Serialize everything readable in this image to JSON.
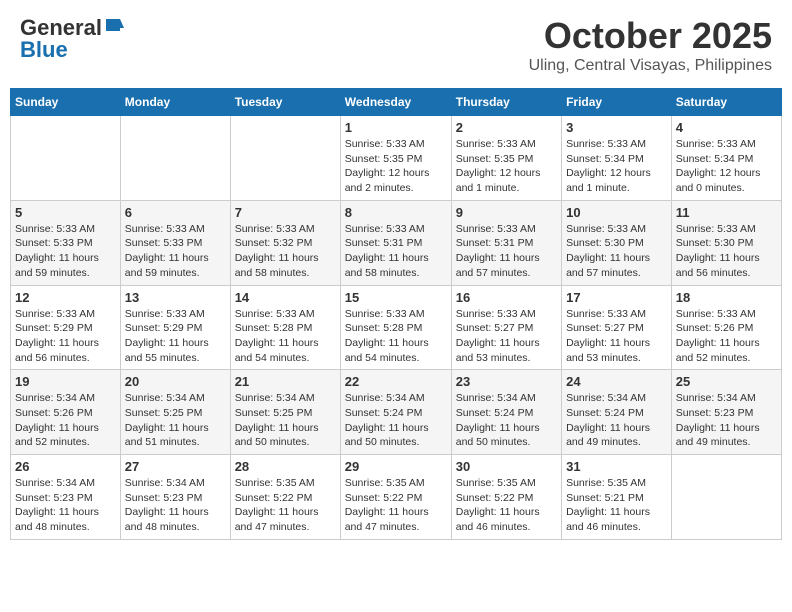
{
  "header": {
    "logo_line1": "General",
    "logo_line2": "Blue",
    "month": "October 2025",
    "location": "Uling, Central Visayas, Philippines"
  },
  "days_of_week": [
    "Sunday",
    "Monday",
    "Tuesday",
    "Wednesday",
    "Thursday",
    "Friday",
    "Saturday"
  ],
  "weeks": [
    [
      {
        "day": "",
        "info": ""
      },
      {
        "day": "",
        "info": ""
      },
      {
        "day": "",
        "info": ""
      },
      {
        "day": "1",
        "info": "Sunrise: 5:33 AM\nSunset: 5:35 PM\nDaylight: 12 hours\nand 2 minutes."
      },
      {
        "day": "2",
        "info": "Sunrise: 5:33 AM\nSunset: 5:35 PM\nDaylight: 12 hours\nand 1 minute."
      },
      {
        "day": "3",
        "info": "Sunrise: 5:33 AM\nSunset: 5:34 PM\nDaylight: 12 hours\nand 1 minute."
      },
      {
        "day": "4",
        "info": "Sunrise: 5:33 AM\nSunset: 5:34 PM\nDaylight: 12 hours\nand 0 minutes."
      }
    ],
    [
      {
        "day": "5",
        "info": "Sunrise: 5:33 AM\nSunset: 5:33 PM\nDaylight: 11 hours\nand 59 minutes."
      },
      {
        "day": "6",
        "info": "Sunrise: 5:33 AM\nSunset: 5:33 PM\nDaylight: 11 hours\nand 59 minutes."
      },
      {
        "day": "7",
        "info": "Sunrise: 5:33 AM\nSunset: 5:32 PM\nDaylight: 11 hours\nand 58 minutes."
      },
      {
        "day": "8",
        "info": "Sunrise: 5:33 AM\nSunset: 5:31 PM\nDaylight: 11 hours\nand 58 minutes."
      },
      {
        "day": "9",
        "info": "Sunrise: 5:33 AM\nSunset: 5:31 PM\nDaylight: 11 hours\nand 57 minutes."
      },
      {
        "day": "10",
        "info": "Sunrise: 5:33 AM\nSunset: 5:30 PM\nDaylight: 11 hours\nand 57 minutes."
      },
      {
        "day": "11",
        "info": "Sunrise: 5:33 AM\nSunset: 5:30 PM\nDaylight: 11 hours\nand 56 minutes."
      }
    ],
    [
      {
        "day": "12",
        "info": "Sunrise: 5:33 AM\nSunset: 5:29 PM\nDaylight: 11 hours\nand 56 minutes."
      },
      {
        "day": "13",
        "info": "Sunrise: 5:33 AM\nSunset: 5:29 PM\nDaylight: 11 hours\nand 55 minutes."
      },
      {
        "day": "14",
        "info": "Sunrise: 5:33 AM\nSunset: 5:28 PM\nDaylight: 11 hours\nand 54 minutes."
      },
      {
        "day": "15",
        "info": "Sunrise: 5:33 AM\nSunset: 5:28 PM\nDaylight: 11 hours\nand 54 minutes."
      },
      {
        "day": "16",
        "info": "Sunrise: 5:33 AM\nSunset: 5:27 PM\nDaylight: 11 hours\nand 53 minutes."
      },
      {
        "day": "17",
        "info": "Sunrise: 5:33 AM\nSunset: 5:27 PM\nDaylight: 11 hours\nand 53 minutes."
      },
      {
        "day": "18",
        "info": "Sunrise: 5:33 AM\nSunset: 5:26 PM\nDaylight: 11 hours\nand 52 minutes."
      }
    ],
    [
      {
        "day": "19",
        "info": "Sunrise: 5:34 AM\nSunset: 5:26 PM\nDaylight: 11 hours\nand 52 minutes."
      },
      {
        "day": "20",
        "info": "Sunrise: 5:34 AM\nSunset: 5:25 PM\nDaylight: 11 hours\nand 51 minutes."
      },
      {
        "day": "21",
        "info": "Sunrise: 5:34 AM\nSunset: 5:25 PM\nDaylight: 11 hours\nand 50 minutes."
      },
      {
        "day": "22",
        "info": "Sunrise: 5:34 AM\nSunset: 5:24 PM\nDaylight: 11 hours\nand 50 minutes."
      },
      {
        "day": "23",
        "info": "Sunrise: 5:34 AM\nSunset: 5:24 PM\nDaylight: 11 hours\nand 50 minutes."
      },
      {
        "day": "24",
        "info": "Sunrise: 5:34 AM\nSunset: 5:24 PM\nDaylight: 11 hours\nand 49 minutes."
      },
      {
        "day": "25",
        "info": "Sunrise: 5:34 AM\nSunset: 5:23 PM\nDaylight: 11 hours\nand 49 minutes."
      }
    ],
    [
      {
        "day": "26",
        "info": "Sunrise: 5:34 AM\nSunset: 5:23 PM\nDaylight: 11 hours\nand 48 minutes."
      },
      {
        "day": "27",
        "info": "Sunrise: 5:34 AM\nSunset: 5:23 PM\nDaylight: 11 hours\nand 48 minutes."
      },
      {
        "day": "28",
        "info": "Sunrise: 5:35 AM\nSunset: 5:22 PM\nDaylight: 11 hours\nand 47 minutes."
      },
      {
        "day": "29",
        "info": "Sunrise: 5:35 AM\nSunset: 5:22 PM\nDaylight: 11 hours\nand 47 minutes."
      },
      {
        "day": "30",
        "info": "Sunrise: 5:35 AM\nSunset: 5:22 PM\nDaylight: 11 hours\nand 46 minutes."
      },
      {
        "day": "31",
        "info": "Sunrise: 5:35 AM\nSunset: 5:21 PM\nDaylight: 11 hours\nand 46 minutes."
      },
      {
        "day": "",
        "info": ""
      }
    ]
  ]
}
